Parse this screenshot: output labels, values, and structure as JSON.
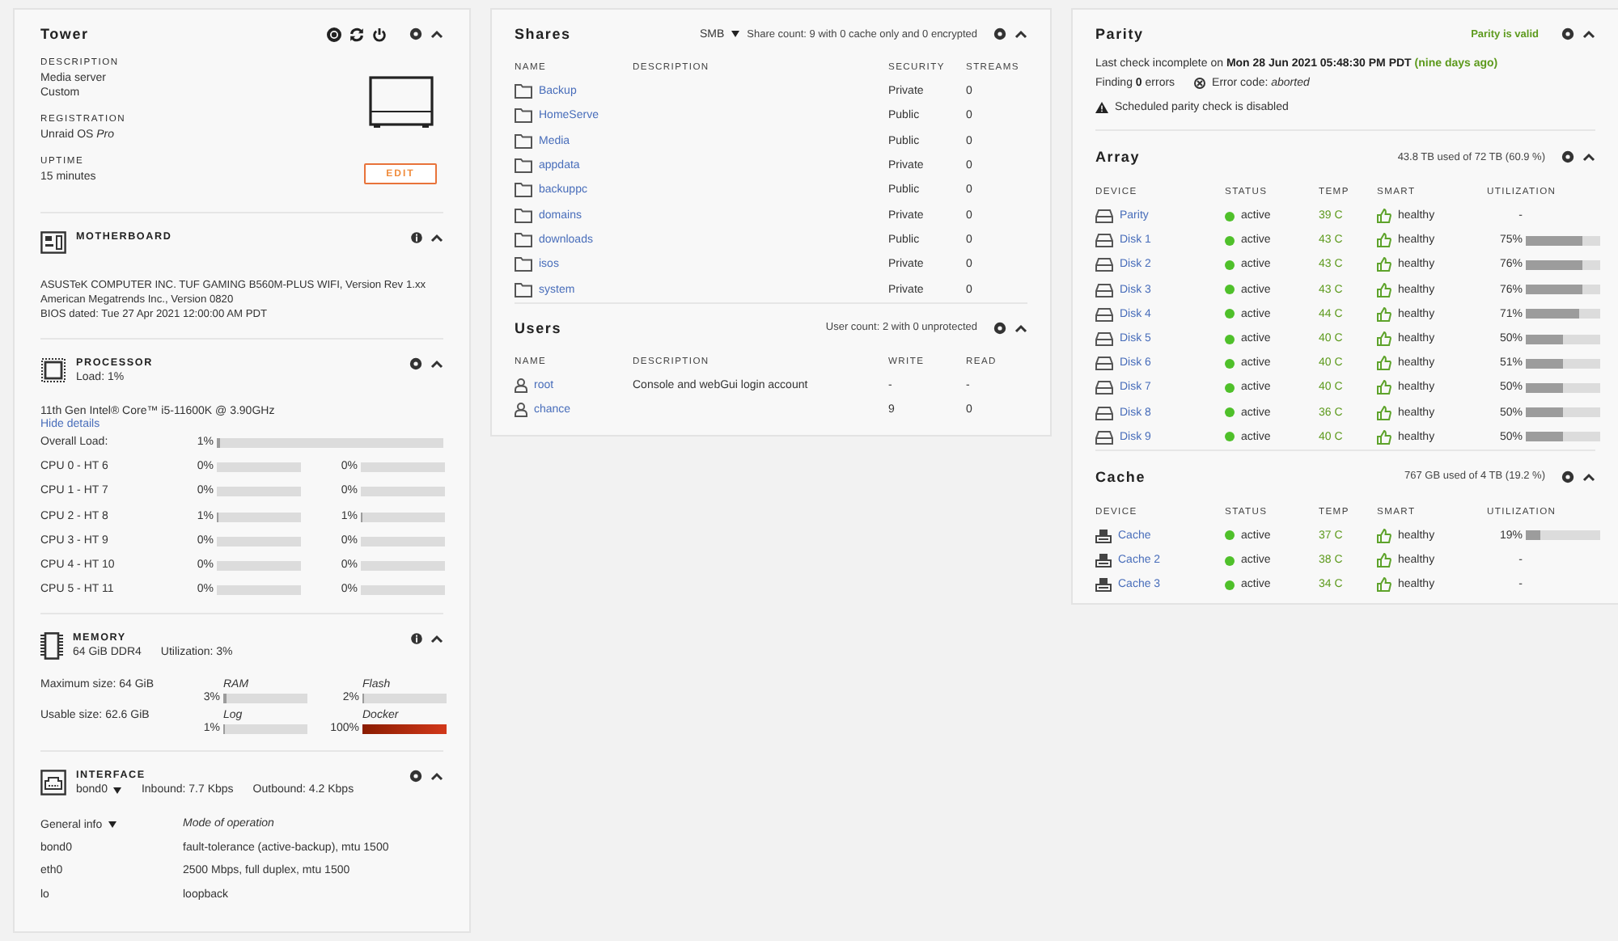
{
  "tower": {
    "title": "Tower",
    "description_label": "DESCRIPTION",
    "description": [
      "Media server",
      "Custom"
    ],
    "registration_label": "REGISTRATION",
    "registration": "Unraid OS *Pro*",
    "uptime_label": "UPTIME",
    "uptime": "15 minutes",
    "edit_button": "EDIT"
  },
  "motherboard": {
    "title": "MOTHERBOARD",
    "lines": [
      "ASUSTeK COMPUTER INC. TUF GAMING B560M-PLUS WIFI, Version Rev 1.xx",
      "American Megatrends Inc., Version 0820",
      "BIOS dated: Tue 27 Apr 2021 12:00:00 AM PDT"
    ]
  },
  "processor": {
    "title": "PROCESSOR",
    "load": "Load: 1%",
    "model": "11th Gen Intel® Core™ i5-11600K @ 3.90GHz",
    "toggle": "Hide details",
    "overall": {
      "label": "Overall Load:",
      "reading": "1%",
      "level": 0.01
    },
    "cpus": [
      {
        "label": "CPU 0 - HT 6",
        "a": {
          "reading": "0%"
        },
        "b": {
          "reading": "0%"
        }
      },
      {
        "label": "CPU 1 - HT 7",
        "a": {
          "reading": "0%"
        },
        "b": {
          "reading": "0%"
        }
      },
      {
        "label": "CPU 2 - HT 8",
        "a": {
          "reading": "1%",
          "level": 0.01
        },
        "b": {
          "reading": "1%",
          "level": 0.01
        }
      },
      {
        "label": "CPU 3 - HT 9",
        "a": {
          "reading": "0%"
        },
        "b": {
          "reading": "0%"
        }
      },
      {
        "label": "CPU 4 - HT 10",
        "a": {
          "reading": "0%"
        },
        "b": {
          "reading": "0%"
        }
      },
      {
        "label": "CPU 5 - HT 11",
        "a": {
          "reading": "0%"
        },
        "b": {
          "reading": "0%"
        }
      }
    ]
  },
  "memory": {
    "title": "MEMORY",
    "size": "64 GiB DDR4",
    "utilization": "Utilization: 3%",
    "max_size": "Maximum size: 64 GiB",
    "usable_size": "Usable size: 62.6 GiB",
    "meters": [
      {
        "name": "RAM",
        "reading": "3%",
        "level": 0.03
      },
      {
        "name": "Flash",
        "reading": "2%",
        "level": 0.02
      },
      {
        "name": "Log",
        "reading": "1%",
        "level": 0.01
      },
      {
        "name": "Docker",
        "reading": "100%",
        "level": 1
      }
    ]
  },
  "interface": {
    "title": "INTERFACE",
    "port": "bond0",
    "inbound": "Inbound: 7.7 Kbps",
    "outbound": "Outbound: 4.2 Kbps",
    "info_select": "General info",
    "info_heading": "Mode of operation",
    "rows": [
      {
        "name": "bond0",
        "value": "fault-tolerance (active-backup), mtu 1500"
      },
      {
        "name": "eth0",
        "value": "2500 Mbps, full duplex, mtu 1500"
      },
      {
        "name": "lo",
        "value": "loopback"
      }
    ]
  },
  "shares": {
    "title": "Shares",
    "protocol": "SMB",
    "summary": "Share count: 9 with 0 cache only and 0 encrypted",
    "columns": [
      "NAME",
      "DESCRIPTION",
      "SECURITY",
      "STREAMS"
    ],
    "rows": [
      {
        "name": "Backup",
        "security": "Private",
        "streams": "0"
      },
      {
        "name": "HomeServe",
        "security": "Public",
        "streams": "0"
      },
      {
        "name": "Media",
        "security": "Public",
        "streams": "0"
      },
      {
        "name": "appdata",
        "security": "Private",
        "streams": "0"
      },
      {
        "name": "backuppc",
        "security": "Public",
        "streams": "0"
      },
      {
        "name": "domains",
        "security": "Private",
        "streams": "0"
      },
      {
        "name": "downloads",
        "security": "Public",
        "streams": "0"
      },
      {
        "name": "isos",
        "security": "Private",
        "streams": "0"
      },
      {
        "name": "system",
        "security": "Private",
        "streams": "0"
      }
    ]
  },
  "users": {
    "title": "Users",
    "summary": "User count: 2 with 0 unprotected",
    "columns": [
      "NAME",
      "DESCRIPTION",
      "WRITE",
      "READ"
    ],
    "rows": [
      {
        "name": "root",
        "description": "Console and webGui login account",
        "write": "-",
        "read": "-"
      },
      {
        "name": "chance",
        "write": "9",
        "read": "0"
      }
    ]
  },
  "parity": {
    "title": "Parity",
    "status": "Parity is valid",
    "check": "Last check incomplete on **Mon 28 Jun 2021 05:48:30 PM PDT**",
    "check_age": "(nine days ago)",
    "finding": "Finding **0** errors",
    "error_code": "Error code: *aborted*",
    "warning": "Scheduled parity check is disabled"
  },
  "array": {
    "title": "Array",
    "summary": "43.8 TB used of 72 TB (60.9 %)",
    "columns": [
      "DEVICE",
      "STATUS",
      "TEMP",
      "SMART",
      "UTILIZATION"
    ],
    "rows": [
      {
        "name": "Parity",
        "status": "active",
        "temp": "39 C",
        "smart": "healthy",
        "utilization": "-"
      },
      {
        "name": "Disk 1",
        "status": "active",
        "temp": "43 C",
        "smart": "healthy",
        "utilization": "75%",
        "level": 0.75
      },
      {
        "name": "Disk 2",
        "status": "active",
        "temp": "43 C",
        "smart": "healthy",
        "utilization": "76%",
        "level": 0.76
      },
      {
        "name": "Disk 3",
        "status": "active",
        "temp": "43 C",
        "smart": "healthy",
        "utilization": "76%",
        "level": 0.76
      },
      {
        "name": "Disk 4",
        "status": "active",
        "temp": "44 C",
        "smart": "healthy",
        "utilization": "71%",
        "level": 0.71
      },
      {
        "name": "Disk 5",
        "status": "active",
        "temp": "40 C",
        "smart": "healthy",
        "utilization": "50%",
        "level": 0.5
      },
      {
        "name": "Disk 6",
        "status": "active",
        "temp": "40 C",
        "smart": "healthy",
        "utilization": "51%",
        "level": 0.51
      },
      {
        "name": "Disk 7",
        "status": "active",
        "temp": "40 C",
        "smart": "healthy",
        "utilization": "50%",
        "level": 0.5
      },
      {
        "name": "Disk 8",
        "status": "active",
        "temp": "36 C",
        "smart": "healthy",
        "utilization": "50%",
        "level": 0.5
      },
      {
        "name": "Disk 9",
        "status": "active",
        "temp": "40 C",
        "smart": "healthy",
        "utilization": "50%",
        "level": 0.5
      }
    ]
  },
  "cache": {
    "title": "Cache",
    "summary": "767 GB used of 4 TB (19.2 %)",
    "columns": [
      "DEVICE",
      "STATUS",
      "TEMP",
      "SMART",
      "UTILIZATION"
    ],
    "rows": [
      {
        "name": "Cache",
        "status": "active",
        "temp": "37 C",
        "smart": "healthy",
        "utilization": "19%",
        "level": 0.19
      },
      {
        "name": "Cache 2",
        "status": "active",
        "temp": "38 C",
        "smart": "healthy",
        "utilization": "-"
      },
      {
        "name": "Cache 3",
        "status": "active",
        "temp": "34 C",
        "smart": "healthy",
        "utilization": "-"
      }
    ]
  }
}
